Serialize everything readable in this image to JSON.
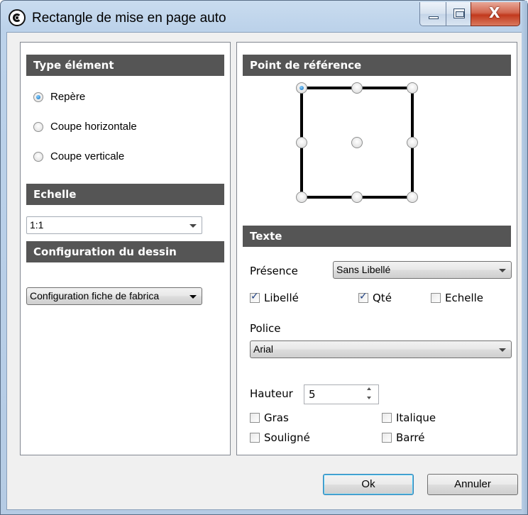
{
  "window": {
    "title": "Rectangle de mise en page auto"
  },
  "left": {
    "type_header": "Type élément",
    "type_options": [
      {
        "label": "Repère",
        "checked": true
      },
      {
        "label": "Coupe horizontale",
        "checked": false
      },
      {
        "label": "Coupe verticale",
        "checked": false
      }
    ],
    "scale_header": "Echelle",
    "scale_value": "1:1",
    "config_header": "Configuration du dessin",
    "config_value": "Configuration fiche de fabrica"
  },
  "right": {
    "ref_header": "Point de référence",
    "ref_selected": "top-left",
    "text_header": "Texte",
    "presence_label": "Présence",
    "presence_value": "Sans Libellé",
    "checks": [
      {
        "label": "Libellé",
        "checked": true
      },
      {
        "label": "Qté",
        "checked": true
      },
      {
        "label": "Echelle",
        "checked": false
      }
    ],
    "font_label": "Police",
    "font_value": "Arial",
    "height_label": "Hauteur",
    "height_value": "5",
    "style_checks": [
      {
        "label": "Gras",
        "checked": false
      },
      {
        "label": "Italique",
        "checked": false
      },
      {
        "label": "Souligné",
        "checked": false
      },
      {
        "label": "Barré",
        "checked": false
      }
    ]
  },
  "buttons": {
    "ok": "Ok",
    "cancel": "Annuler"
  }
}
